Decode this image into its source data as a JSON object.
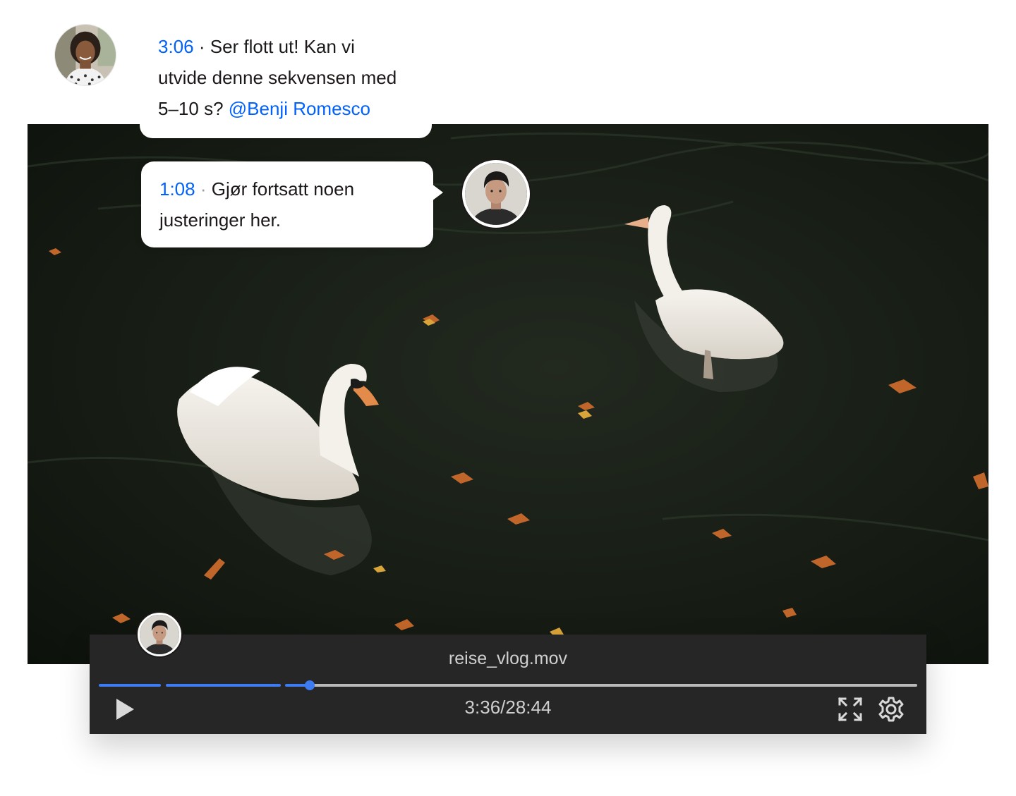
{
  "video": {
    "file_name": "reise_vlog.mov",
    "time_display": "3:36/28:44",
    "progress": 0.125,
    "scene": "two swans on dark water with autumn leaves"
  },
  "comments": [
    {
      "timestamp": "3:06",
      "separator": "·",
      "text_line1": "Ser flott ut! Kan vi",
      "text_line2": "utvide denne sekvensen med",
      "text_line3": "5–10 s?",
      "mention": "@Benji Romesco"
    },
    {
      "timestamp": "1:08",
      "separator": "·",
      "text_line1": "Gjør fortsatt noen",
      "text_line2": "justeringer her."
    }
  ],
  "icons": {
    "play": "play-icon",
    "fullscreen": "fullscreen-icon",
    "settings": "gear-icon"
  },
  "colors": {
    "accent": "#0061fe",
    "player_bg": "#262626",
    "progress": "#3d7cf0",
    "track": "#b9b9b9",
    "text": "#1e1919"
  }
}
